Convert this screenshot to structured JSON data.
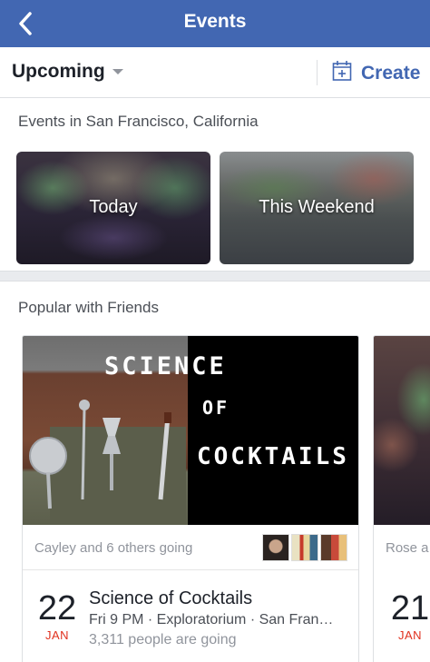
{
  "nav": {
    "title": "Events",
    "back_icon": "chevron-left-icon"
  },
  "toolbar": {
    "filter_label": "Upcoming",
    "create_label": "Create",
    "create_icon": "calendar-plus-icon"
  },
  "nearby": {
    "title": "Events in San Francisco, California",
    "tiles": [
      {
        "label": "Today"
      },
      {
        "label": "This Weekend"
      }
    ]
  },
  "popular": {
    "title": "Popular with Friends",
    "events": [
      {
        "cover_text": [
          "SCIENCE",
          "OF",
          "COCKTAILS"
        ],
        "going": "Cayley and 6 others going",
        "day": "22",
        "month": "JAN",
        "title": "Science of Cocktails",
        "meta": "Fri 9 PM · Exploratorium · San Fran…",
        "count": "3,311 people are going"
      },
      {
        "going": "Rose a",
        "day": "21",
        "month": "JAN"
      }
    ]
  },
  "colors": {
    "nav_bg": "#4267b2",
    "link": "#4267b2",
    "date_month": "#e0301e",
    "secondary_text": "#90949c"
  }
}
